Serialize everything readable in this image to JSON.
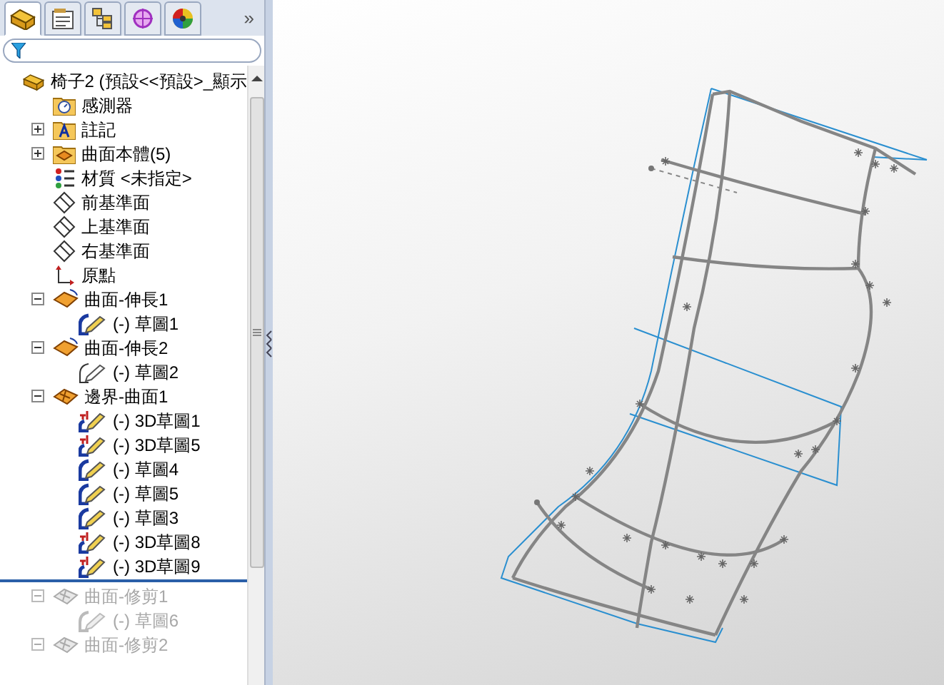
{
  "panel_tabs": [
    {
      "kind": "part",
      "selected": true
    },
    {
      "kind": "properties",
      "selected": false
    },
    {
      "kind": "config",
      "selected": false
    },
    {
      "kind": "target",
      "selected": false
    },
    {
      "kind": "appearance",
      "selected": false
    }
  ],
  "more_tabs": "»",
  "tree": [
    {
      "kind": "part",
      "label": "椅子2 (預設<<預設>_顯示",
      "children": [
        {
          "kind": "sensor",
          "label": "感測器"
        },
        {
          "kind": "annotation",
          "label": "註記",
          "expanded": false
        },
        {
          "kind": "bodies",
          "label": "曲面本體(5)",
          "expanded": false
        },
        {
          "kind": "material",
          "label": "材質 <未指定>"
        },
        {
          "kind": "plane",
          "label": "前基準面"
        },
        {
          "kind": "plane",
          "label": "上基準面"
        },
        {
          "kind": "plane",
          "label": "右基準面"
        },
        {
          "kind": "origin",
          "label": "原點"
        },
        {
          "kind": "extrude",
          "label": "曲面-伸長1",
          "expanded": true,
          "children": [
            {
              "kind": "sketch",
              "label": "(-) 草圖1"
            }
          ]
        },
        {
          "kind": "extrude",
          "label": "曲面-伸長2",
          "expanded": true,
          "children": [
            {
              "kind": "sketch_open",
              "label": "(-) 草圖2"
            }
          ]
        },
        {
          "kind": "boundary",
          "label": "邊界-曲面1",
          "expanded": true,
          "children": [
            {
              "kind": "sketch3d",
              "label": "(-) 3D草圖1"
            },
            {
              "kind": "sketch3d",
              "label": "(-) 3D草圖5"
            },
            {
              "kind": "sketch",
              "label": "(-) 草圖4"
            },
            {
              "kind": "sketch",
              "label": "(-) 草圖5"
            },
            {
              "kind": "sketch",
              "label": "(-) 草圖3"
            },
            {
              "kind": "sketch3d",
              "label": "(-) 3D草圖8"
            },
            {
              "kind": "sketch3d",
              "label": "(-) 3D草圖9"
            }
          ]
        },
        {
          "kind": "trim",
          "label": "曲面-修剪1",
          "expanded": true,
          "rolled_back": true,
          "children": [
            {
              "kind": "sketch_grey",
              "label": "(-) 草圖6",
              "rolled_back": true
            }
          ]
        },
        {
          "kind": "trim",
          "label": "曲面-修剪2",
          "expanded": true,
          "rolled_back": true
        }
      ]
    }
  ]
}
